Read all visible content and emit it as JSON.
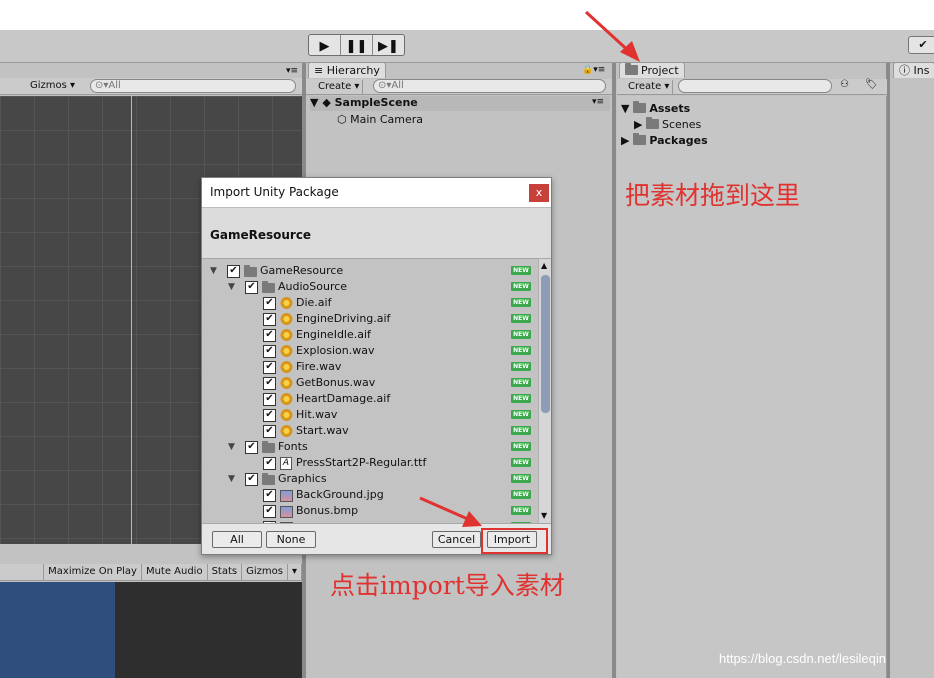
{
  "toolbar": {
    "play_icon": "play-icon",
    "pause_icon": "pause-icon",
    "step_icon": "step-icon",
    "collab_icon": "check-icon"
  },
  "scene": {
    "gizmos_label": "Gizmos",
    "search_placeholder": "All"
  },
  "game": {
    "tabs": [
      "Maximize On Play",
      "Mute Audio",
      "Stats",
      "Gizmos"
    ],
    "colors": {
      "left": "#2f4d7d",
      "right": "#2e2e2e"
    }
  },
  "hierarchy": {
    "tab_label": "Hierarchy",
    "create_label": "Create",
    "search_placeholder": "All",
    "scene_name": "SampleScene",
    "items": [
      "Main Camera"
    ]
  },
  "project": {
    "tab_label": "Project",
    "create_label": "Create",
    "tree": {
      "assets": "Assets",
      "scenes": "Scenes",
      "packages": "Packages"
    }
  },
  "inspector": {
    "tab_label": "Ins"
  },
  "dialog": {
    "title": "Import Unity Package",
    "close_label": "x",
    "package_name": "GameResource",
    "new_badge": "NEW",
    "items": [
      {
        "name": "GameResource",
        "kind": "folder",
        "depth": 0,
        "expanded": true,
        "checked": true
      },
      {
        "name": "AudioSource",
        "kind": "folder",
        "depth": 1,
        "expanded": true,
        "checked": true
      },
      {
        "name": "Die.aif",
        "kind": "audio",
        "depth": 2,
        "checked": true
      },
      {
        "name": "EngineDriving.aif",
        "kind": "audio",
        "depth": 2,
        "checked": true
      },
      {
        "name": "EngineIdle.aif",
        "kind": "audio",
        "depth": 2,
        "checked": true
      },
      {
        "name": "Explosion.wav",
        "kind": "audio",
        "depth": 2,
        "checked": true
      },
      {
        "name": "Fire.wav",
        "kind": "audio",
        "depth": 2,
        "checked": true
      },
      {
        "name": "GetBonus.wav",
        "kind": "audio",
        "depth": 2,
        "checked": true
      },
      {
        "name": "HeartDamage.aif",
        "kind": "audio",
        "depth": 2,
        "checked": true
      },
      {
        "name": "Hit.wav",
        "kind": "audio",
        "depth": 2,
        "checked": true
      },
      {
        "name": "Start.wav",
        "kind": "audio",
        "depth": 2,
        "checked": true
      },
      {
        "name": "Fonts",
        "kind": "folder",
        "depth": 1,
        "expanded": true,
        "checked": true
      },
      {
        "name": "PressStart2P-Regular.ttf",
        "kind": "font",
        "depth": 2,
        "checked": true
      },
      {
        "name": "Graphics",
        "kind": "folder",
        "depth": 1,
        "expanded": true,
        "checked": true
      },
      {
        "name": "BackGround.jpg",
        "kind": "image",
        "depth": 2,
        "checked": true
      },
      {
        "name": "Bonus.bmp",
        "kind": "image",
        "depth": 2,
        "checked": true
      },
      {
        "name": "",
        "kind": "image",
        "depth": 2,
        "checked": true
      }
    ],
    "buttons": {
      "all": "All",
      "none": "None",
      "cancel": "Cancel",
      "import": "Import"
    }
  },
  "annotations": {
    "drag_here": "把素材拖到这里",
    "click_import": "点击import导入素材",
    "color": "#e0322f"
  },
  "watermark": "https://blog.csdn.net/lesileqin"
}
